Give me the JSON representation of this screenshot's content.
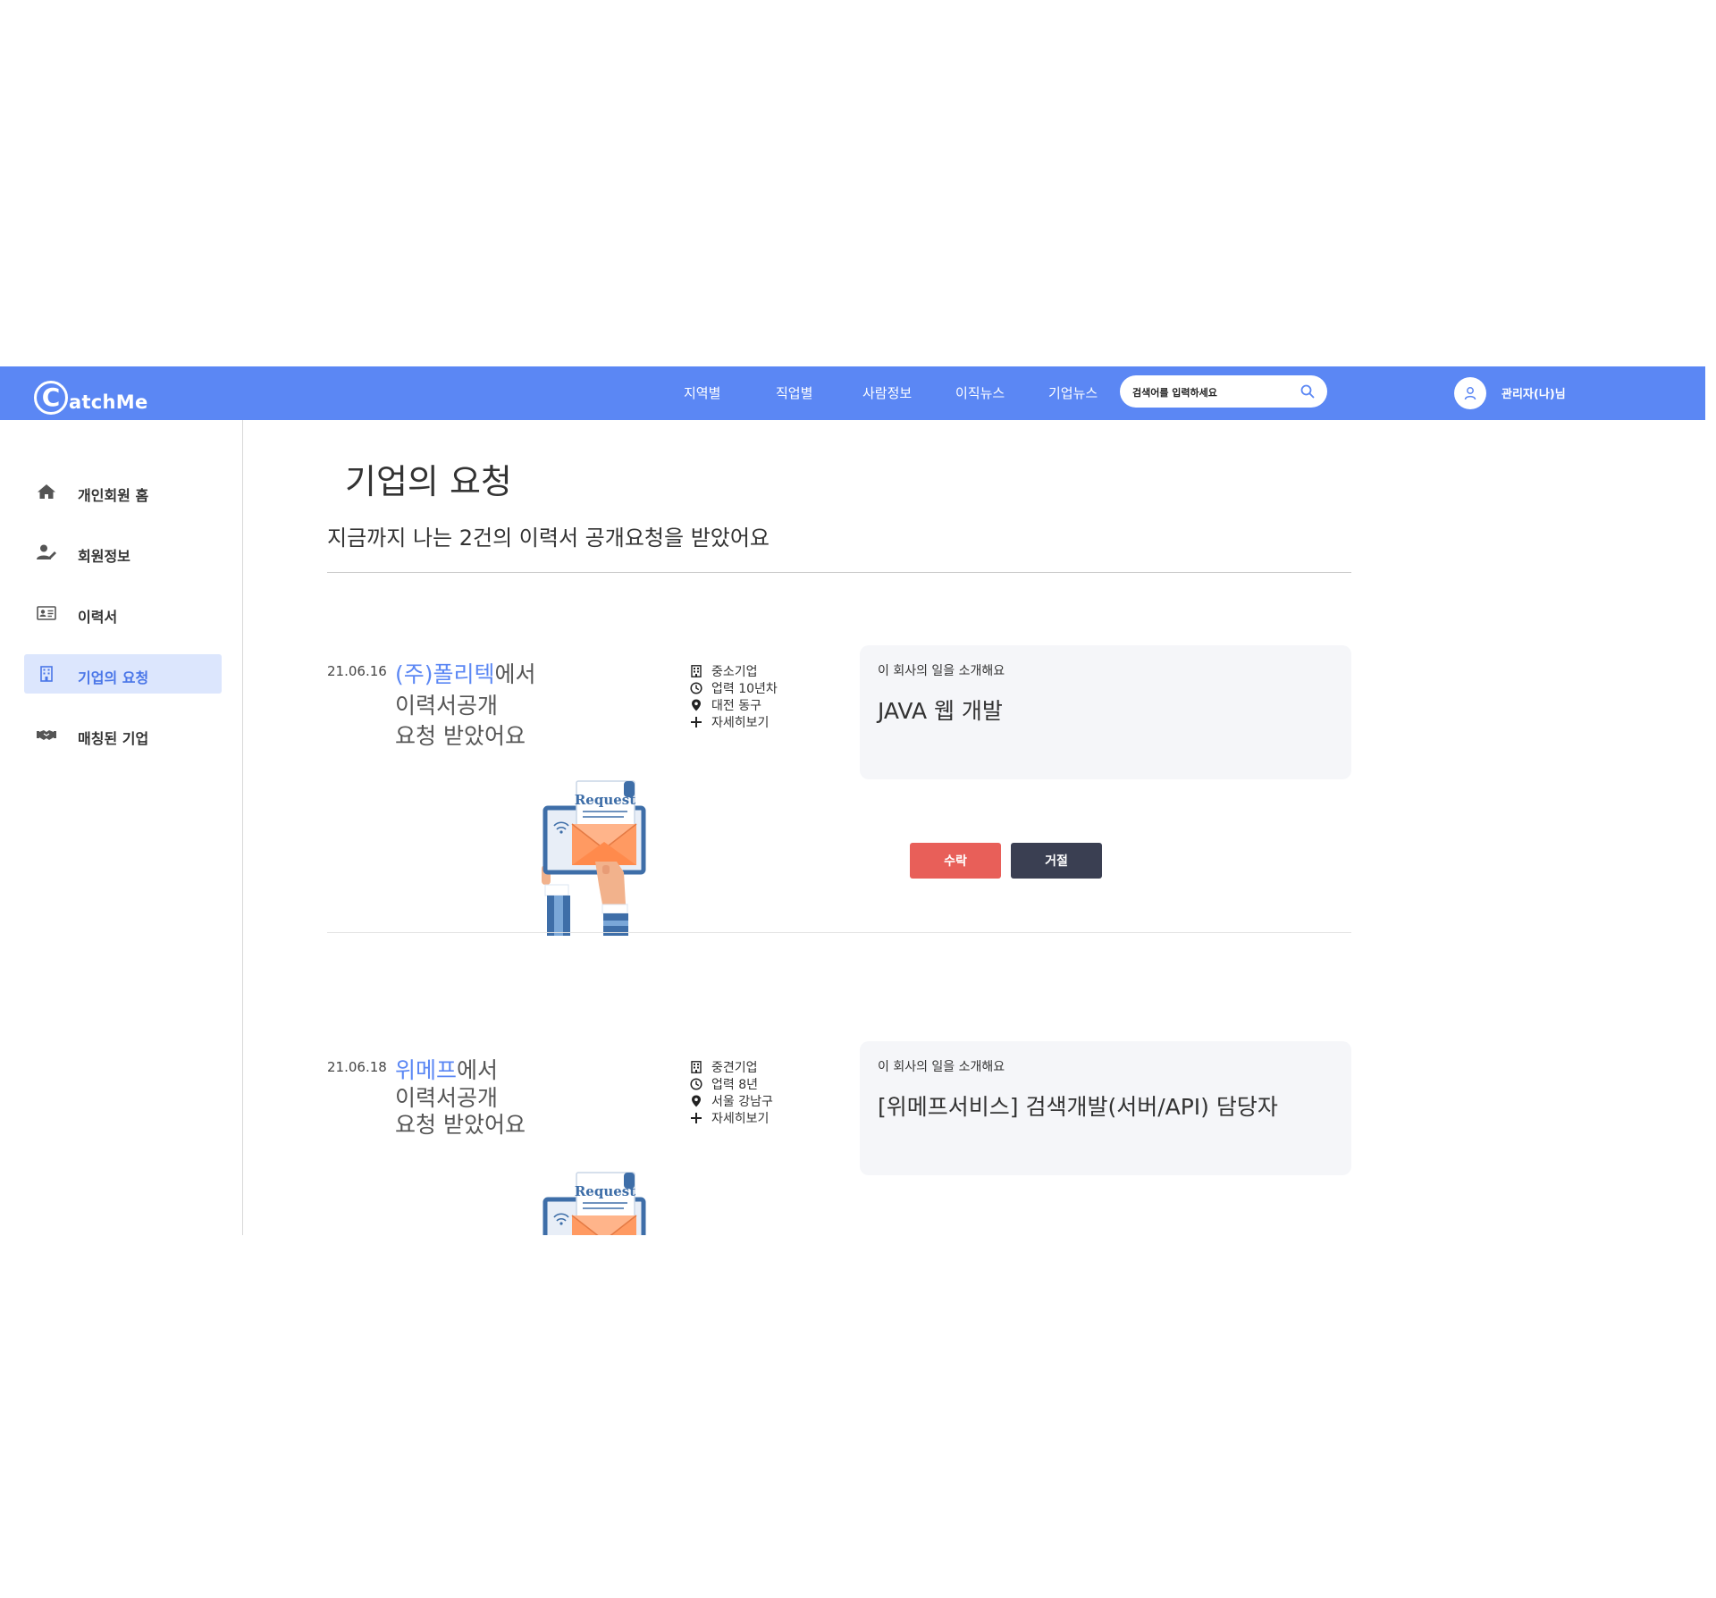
{
  "header": {
    "logo_mark": "C",
    "logo_text": "atchMe",
    "nav": [
      "지역별",
      "직업별",
      "사람정보",
      "이직뉴스",
      "기업뉴스"
    ],
    "search_placeholder": "검색어를 입력하세요",
    "user_name": "관리자(나)님"
  },
  "sidebar": {
    "items": [
      {
        "label": "개인회원 홈",
        "icon": "home-icon"
      },
      {
        "label": "회원정보",
        "icon": "user-edit-icon"
      },
      {
        "label": "이력서",
        "icon": "id-card-icon"
      },
      {
        "label": "기업의 요청",
        "icon": "building-icon",
        "active": true
      },
      {
        "label": "매칭된 기업",
        "icon": "handshake-icon"
      }
    ]
  },
  "main": {
    "title": "기업의 요청",
    "subtitle": "지금까지 나는 2건의 이력서 공개요청을 받았어요",
    "requests": [
      {
        "date": "21.06.16",
        "company": "(주)폴리텍",
        "line1_suffix": "에서",
        "line2": "이력서공개",
        "line3": "요청 받았어요",
        "company_type": "중소기업",
        "history": "업력 10년차",
        "location": "대전 동구",
        "details": "자세히보기",
        "card_label": "이 회사의 일을 소개해요",
        "card_title": "JAVA 웹 개발",
        "illustration_text": "Request",
        "accept_label": "수락",
        "reject_label": "거절"
      },
      {
        "date": "21.06.18",
        "company": "위메프",
        "line1_suffix": "에서",
        "line2": "이력서공개",
        "line3": "요청 받았어요",
        "company_type": "중견기업",
        "history": "업력 8년",
        "location": "서울 강남구",
        "details": "자세히보기",
        "card_label": "이 회사의 일을 소개해요",
        "card_title": "[위메프서비스] 검색개발(서버/API) 담당자",
        "illustration_text": "Request"
      }
    ]
  },
  "colors": {
    "brand": "#5b87f4",
    "accept": "#e85f59",
    "reject": "#3a3f52",
    "active_bg": "#dce6fd"
  }
}
